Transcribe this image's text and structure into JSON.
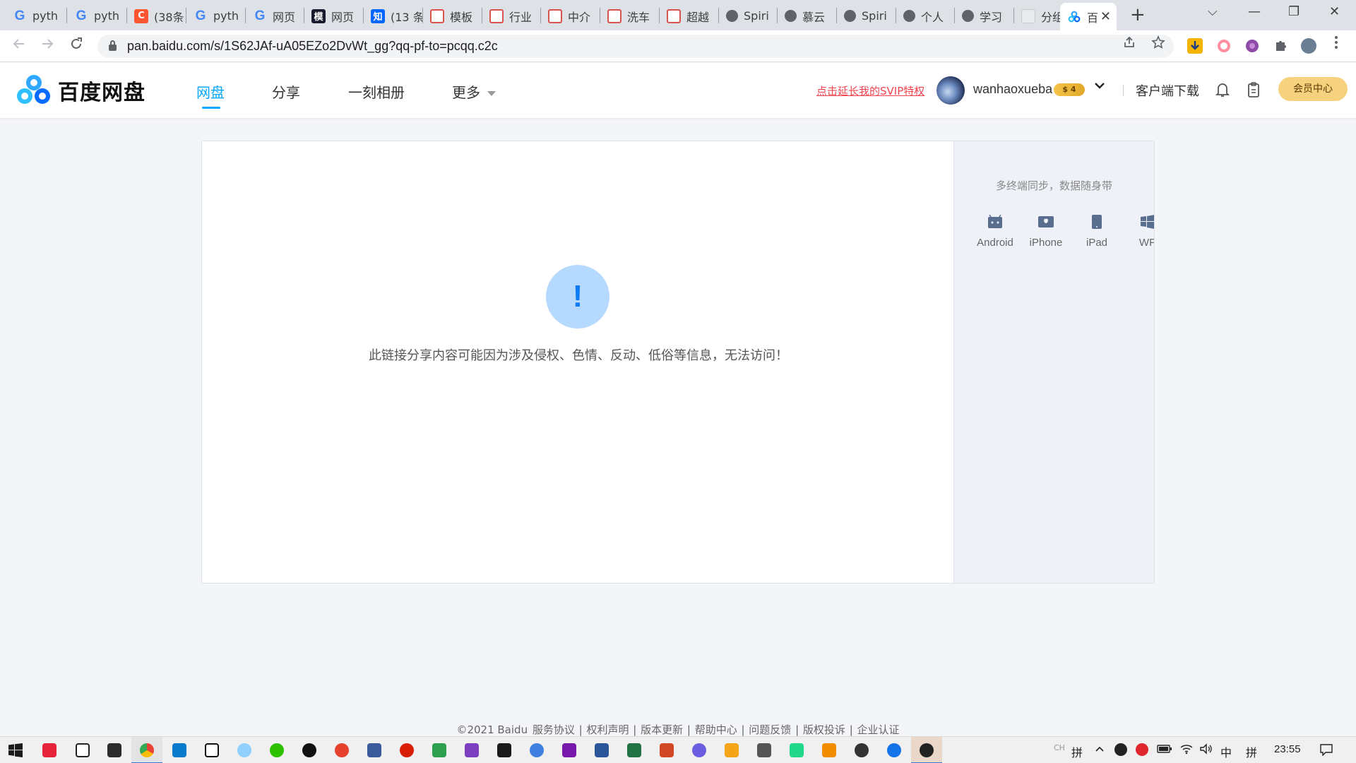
{
  "browser": {
    "tabs": [
      {
        "title": "pyth",
        "favicon": "google-icon"
      },
      {
        "title": "pyth",
        "favicon": "google-icon"
      },
      {
        "title": "(38条",
        "favicon": "csdn-icon"
      },
      {
        "title": "pyth",
        "favicon": "google-icon"
      },
      {
        "title": "网页",
        "favicon": "google-icon"
      },
      {
        "title": "网页",
        "favicon": "mo-icon"
      },
      {
        "title": "(13 条",
        "favicon": "zhihu-icon"
      },
      {
        "title": "模板",
        "favicon": "red-site-icon"
      },
      {
        "title": "行业",
        "favicon": "red-site-icon"
      },
      {
        "title": "中介",
        "favicon": "red-site-icon"
      },
      {
        "title": "洗车",
        "favicon": "red-site-icon"
      },
      {
        "title": "超越",
        "favicon": "red-site-icon"
      },
      {
        "title": "Spiri",
        "favicon": "globe-icon"
      },
      {
        "title": "慕云",
        "favicon": "globe-icon"
      },
      {
        "title": "Spiri",
        "favicon": "globe-icon"
      },
      {
        "title": "个人",
        "favicon": "globe-icon"
      },
      {
        "title": "学习",
        "favicon": "globe-icon"
      },
      {
        "title": "分组",
        "favicon": "blank-icon"
      },
      {
        "title": "百",
        "favicon": "baidu-pan-icon",
        "active": true
      }
    ],
    "url": "pan.baidu.com/s/1S62JAf-uA05EZo2DvWt_gg?qq-pf-to=pcqq.c2c",
    "fav_glyph_google": "G",
    "fav_glyph_csdn": "C",
    "fav_glyph_mo": "模",
    "fav_glyph_zhihu": "知",
    "new_tab": "+",
    "close_tab": "✕",
    "win_chevron": "⌵",
    "win_minimize": "—",
    "win_restore": "❐",
    "win_close": "✕"
  },
  "header": {
    "logo_text": "百度网盘",
    "nav": [
      {
        "label": "网盘",
        "active": true
      },
      {
        "label": "分享"
      },
      {
        "label": "一刻相册"
      },
      {
        "label": "更多"
      }
    ],
    "svip_link": "点击延长我的SVIP特权",
    "username": "wanhaoxueba",
    "vip_badge": "$ 4",
    "client_download": "客户端下载",
    "member_center": "会员中心"
  },
  "main": {
    "warning_icon": "!",
    "warning_text": "此链接分享内容可能因为涉及侵权、色情、反动、低俗等信息，无法访问！",
    "sidebar": {
      "title": "多终端同步，数据随身带",
      "platforms": [
        {
          "label": "Android",
          "icon": "android-icon"
        },
        {
          "label": "iPhone",
          "icon": "iphone-icon"
        },
        {
          "label": "iPad",
          "icon": "ipad-icon"
        },
        {
          "label": "WP",
          "icon": "windows-phone-icon"
        }
      ]
    }
  },
  "footer": {
    "copyright": "©2021 Baidu",
    "links": [
      "服务协议",
      "权利声明",
      "版本更新",
      "帮助中心",
      "问题反馈",
      "版权投诉",
      "企业认证"
    ]
  },
  "taskbar": {
    "tray_input_ch": "中",
    "tray_input_pin": "拼",
    "tray_input_pin2": "拼",
    "tray_ch_small": "CH",
    "time": "23:55"
  },
  "colors": {
    "accent": "#06a7ff",
    "svip_red": "#f0434f",
    "member_gold": "#f6d27e",
    "warning_circle": "#b5d9ff",
    "warning_mark": "#0d7bf5"
  }
}
